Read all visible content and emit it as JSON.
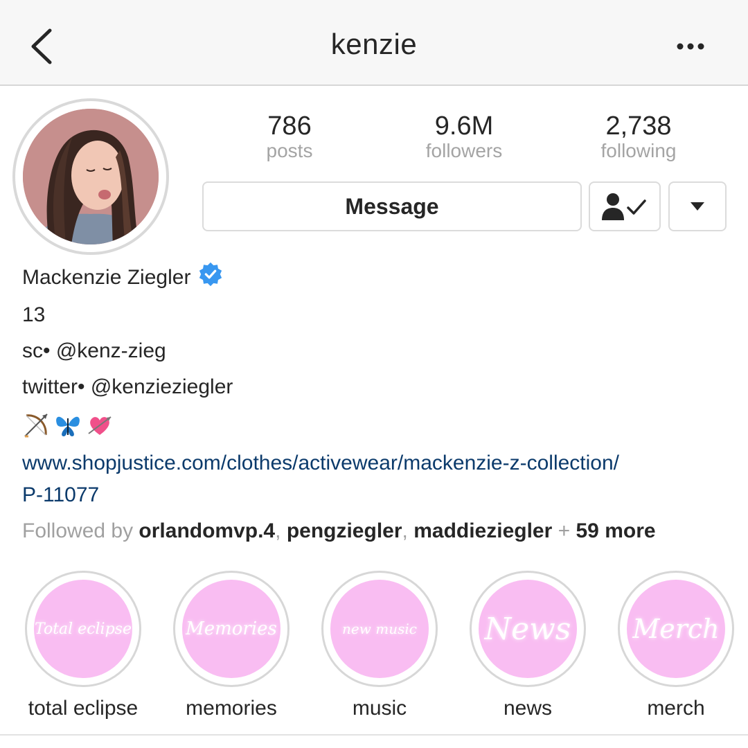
{
  "header": {
    "title": "kenzie",
    "back_icon": "chevron-left-icon",
    "more_icon": "ellipsis-icon"
  },
  "profile": {
    "avatar_icon": "profile-photo",
    "stats": [
      {
        "value": "786",
        "label": "posts"
      },
      {
        "value": "9.6M",
        "label": "followers"
      },
      {
        "value": "2,738",
        "label": "following"
      }
    ],
    "actions": {
      "message_label": "Message",
      "following_icon": "person-check-icon",
      "dropdown_icon": "caret-down-icon"
    }
  },
  "bio": {
    "name": "Mackenzie Ziegler",
    "verified_icon": "verified-badge-icon",
    "verified_color": "#3897f0",
    "age": "13",
    "sc": "sc• @kenz-zieg",
    "twitter": "twitter• @kenzieziegler",
    "emojis": [
      "bow-and-arrow-icon",
      "butterfly-icon",
      "heart-with-arrow-icon"
    ],
    "link_line1": "www.shopjustice.com/clothes/activewear/mackenzie-z-collection/",
    "link_line2": "P-11077",
    "link_color": "#0b3a6b",
    "followed_by": {
      "prefix": "Followed by",
      "users": [
        "orlandomvp.4",
        "pengziegler",
        "maddieziegler"
      ],
      "separator": ",",
      "plus": "+",
      "more": "59 more"
    }
  },
  "highlights": [
    {
      "cover_text": "Total eclipse",
      "label": "total eclipse"
    },
    {
      "cover_text": "Memories",
      "label": "memories"
    },
    {
      "cover_text": "new music",
      "label": "music"
    },
    {
      "cover_text": "News",
      "label": "news"
    },
    {
      "cover_text": "Merch",
      "label": "merch"
    }
  ],
  "colors": {
    "highlight_fill": "#f9bdf2",
    "header_bg": "#f7f7f7",
    "muted_text": "#a0a0a0"
  }
}
